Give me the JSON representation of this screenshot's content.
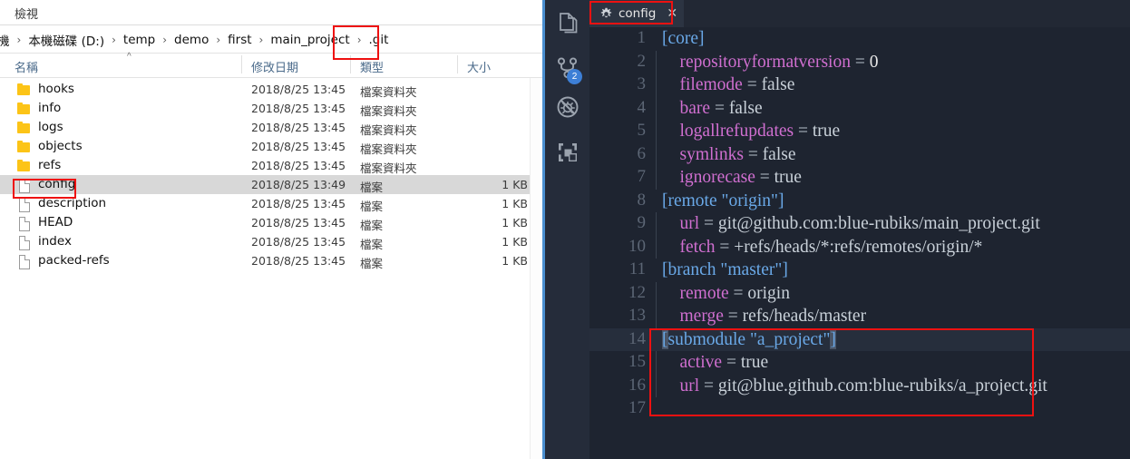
{
  "explorer": {
    "ribbon_tab": "檢視",
    "breadcrumbs": [
      {
        "label": "機",
        "sep": "›"
      },
      {
        "label": "本機磁碟 (D:)",
        "sep": "›"
      },
      {
        "label": "temp",
        "sep": "›"
      },
      {
        "label": "demo",
        "sep": "›"
      },
      {
        "label": "first",
        "sep": "›"
      },
      {
        "label": "main_project",
        "sep": "›"
      },
      {
        "label": ".git",
        "sep": ""
      }
    ],
    "columns": {
      "name": "名稱",
      "date_modified": "修改日期",
      "type": "類型",
      "size": "大小",
      "sort_caret": "^"
    },
    "rows": [
      {
        "icon": "folder-icon",
        "name": "hooks",
        "date": "2018/8/25 13:45",
        "type": "檔案資料夾",
        "size": "",
        "selected": false
      },
      {
        "icon": "folder-icon",
        "name": "info",
        "date": "2018/8/25 13:45",
        "type": "檔案資料夾",
        "size": "",
        "selected": false
      },
      {
        "icon": "folder-icon",
        "name": "logs",
        "date": "2018/8/25 13:45",
        "type": "檔案資料夾",
        "size": "",
        "selected": false
      },
      {
        "icon": "folder-icon",
        "name": "objects",
        "date": "2018/8/25 13:45",
        "type": "檔案資料夾",
        "size": "",
        "selected": false
      },
      {
        "icon": "folder-icon",
        "name": "refs",
        "date": "2018/8/25 13:45",
        "type": "檔案資料夾",
        "size": "",
        "selected": false
      },
      {
        "icon": "file-icon",
        "name": "config",
        "date": "2018/8/25 13:49",
        "type": "檔案",
        "size": "1 KB",
        "selected": true
      },
      {
        "icon": "file-icon",
        "name": "description",
        "date": "2018/8/25 13:45",
        "type": "檔案",
        "size": "1 KB",
        "selected": false
      },
      {
        "icon": "file-icon",
        "name": "HEAD",
        "date": "2018/8/25 13:45",
        "type": "檔案",
        "size": "1 KB",
        "selected": false
      },
      {
        "icon": "file-icon",
        "name": "index",
        "date": "2018/8/25 13:45",
        "type": "檔案",
        "size": "1 KB",
        "selected": false
      },
      {
        "icon": "file-icon",
        "name": "packed-refs",
        "date": "2018/8/25 13:45",
        "type": "檔案",
        "size": "1 KB",
        "selected": false
      }
    ]
  },
  "vscode": {
    "activity_bar": [
      {
        "icon": "explorer-files-icon",
        "badge": ""
      },
      {
        "icon": "source-control-icon",
        "badge": "2"
      },
      {
        "icon": "run-debug-icon",
        "badge": ""
      },
      {
        "icon": "extensions-icon",
        "badge": ""
      }
    ],
    "tab": {
      "icon": "gear-icon",
      "title": "config",
      "close_label": "✕"
    },
    "editor": {
      "lines": [
        {
          "num": "1",
          "tokens": [
            {
              "t": "[core]",
              "c": "section"
            }
          ]
        },
        {
          "num": "2",
          "tokens": [
            {
              "t": "    repositoryformatversion",
              "c": "key"
            },
            {
              "t": " = ",
              "c": "eq"
            },
            {
              "t": "0",
              "c": "num"
            }
          ]
        },
        {
          "num": "3",
          "tokens": [
            {
              "t": "    filemode",
              "c": "key"
            },
            {
              "t": " = ",
              "c": "eq"
            },
            {
              "t": "false",
              "c": "val"
            }
          ]
        },
        {
          "num": "4",
          "tokens": [
            {
              "t": "    bare",
              "c": "key"
            },
            {
              "t": " = ",
              "c": "eq"
            },
            {
              "t": "false",
              "c": "val"
            }
          ]
        },
        {
          "num": "5",
          "tokens": [
            {
              "t": "    logallrefupdates",
              "c": "key"
            },
            {
              "t": " = ",
              "c": "eq"
            },
            {
              "t": "true",
              "c": "val"
            }
          ]
        },
        {
          "num": "6",
          "tokens": [
            {
              "t": "    symlinks",
              "c": "key"
            },
            {
              "t": " = ",
              "c": "eq"
            },
            {
              "t": "false",
              "c": "val"
            }
          ]
        },
        {
          "num": "7",
          "tokens": [
            {
              "t": "    ignorecase",
              "c": "key"
            },
            {
              "t": " = ",
              "c": "eq"
            },
            {
              "t": "true",
              "c": "val"
            }
          ]
        },
        {
          "num": "8",
          "tokens": [
            {
              "t": "[remote \"origin\"]",
              "c": "section"
            }
          ]
        },
        {
          "num": "9",
          "tokens": [
            {
              "t": "    url",
              "c": "key"
            },
            {
              "t": " = ",
              "c": "eq"
            },
            {
              "t": "git@github.com:blue-rubiks/main_project.git",
              "c": "val"
            }
          ]
        },
        {
          "num": "10",
          "tokens": [
            {
              "t": "    fetch",
              "c": "key"
            },
            {
              "t": " = ",
              "c": "eq"
            },
            {
              "t": "+refs/heads/*:refs/remotes/origin/*",
              "c": "val"
            }
          ]
        },
        {
          "num": "11",
          "tokens": [
            {
              "t": "[branch \"master\"]",
              "c": "section"
            }
          ]
        },
        {
          "num": "12",
          "tokens": [
            {
              "t": "    remote",
              "c": "key"
            },
            {
              "t": " = ",
              "c": "eq"
            },
            {
              "t": "origin",
              "c": "val"
            }
          ]
        },
        {
          "num": "13",
          "tokens": [
            {
              "t": "    merge",
              "c": "key"
            },
            {
              "t": " = ",
              "c": "eq"
            },
            {
              "t": "refs/heads/master",
              "c": "val"
            }
          ]
        },
        {
          "num": "14",
          "current": true,
          "tokens": [
            {
              "t": "[",
              "c": "section",
              "sel": true
            },
            {
              "t": "submodule \"a_project\"",
              "c": "section"
            },
            {
              "t": "]",
              "c": "section",
              "sel": true
            }
          ]
        },
        {
          "num": "15",
          "tokens": [
            {
              "t": "    active",
              "c": "key"
            },
            {
              "t": " = ",
              "c": "eq"
            },
            {
              "t": "true",
              "c": "val"
            }
          ]
        },
        {
          "num": "16",
          "tokens": [
            {
              "t": "    url",
              "c": "key"
            },
            {
              "t": " = ",
              "c": "eq"
            },
            {
              "t": "git@blue.github.com:blue-rubiks/a_project.git",
              "c": "val"
            }
          ]
        },
        {
          "num": "17",
          "tokens": []
        }
      ]
    }
  },
  "annotations": {
    "color": "#ee1111",
    "boxes": [
      {
        "name": "redbox-git-breadcrumb"
      },
      {
        "name": "redbox-config-file-row"
      },
      {
        "name": "redbox-config-tab"
      },
      {
        "name": "redbox-submodule-section"
      }
    ]
  }
}
